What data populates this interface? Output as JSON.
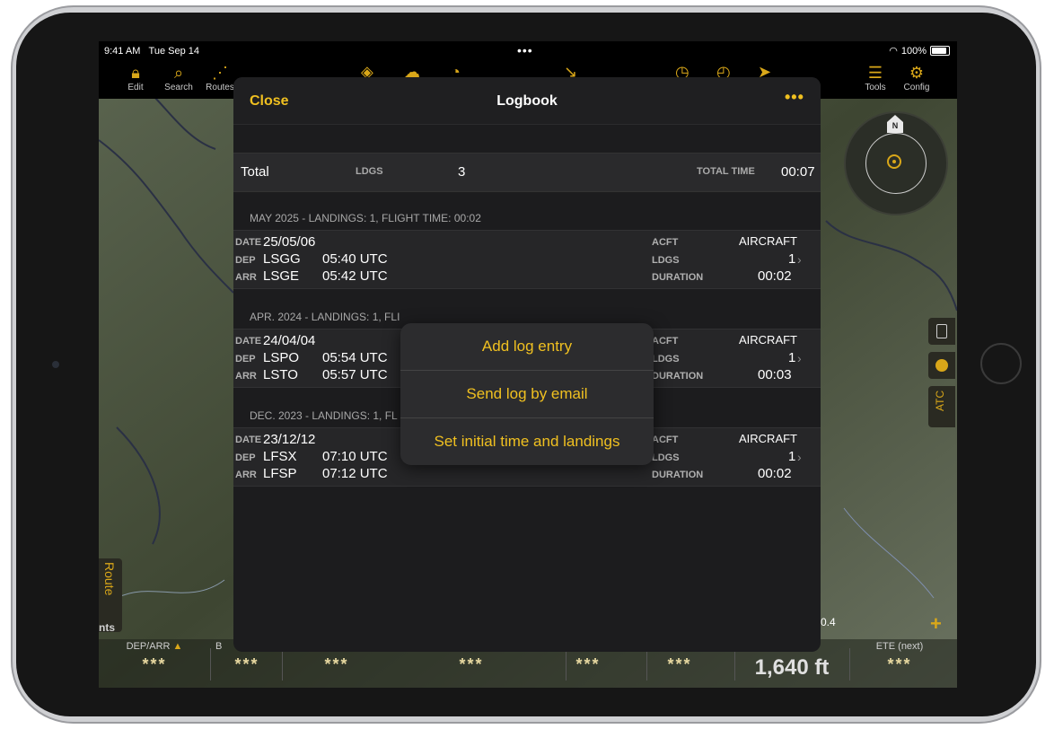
{
  "status_bar": {
    "time": "9:41 AM",
    "date": "Tue Sep 14",
    "battery": "100%"
  },
  "toolbar": {
    "items": [
      {
        "label": "Edit",
        "icon": "lock-icon"
      },
      {
        "label": "Search",
        "icon": "search-icon"
      },
      {
        "label": "Routes",
        "icon": "routes-icon"
      },
      {
        "label": "Tools",
        "icon": "menu-icon"
      },
      {
        "label": "Config",
        "icon": "gear-icon"
      }
    ]
  },
  "logbook": {
    "close_label": "Close",
    "title": "Logbook",
    "more_label": "•••",
    "total": {
      "label": "Total",
      "ldgs_label": "LDGS",
      "ldgs_value": "3",
      "total_time_label": "TOTAL TIME",
      "total_time_value": "00:07"
    },
    "sections": [
      {
        "header": "MAY 2025 - LANDINGS: 1, FLIGHT TIME: 00:02",
        "entry": {
          "date_label": "DATE",
          "date": "25/05/06",
          "dep_label": "DEP",
          "dep": "LSGG",
          "dep_time": "05:40 UTC",
          "arr_label": "ARR",
          "arr": "LSGE",
          "arr_time": "05:42 UTC",
          "acft_label": "ACFT",
          "acft": "AIRCRAFT",
          "ldgs_label": "LDGS",
          "ldgs": "1",
          "duration_label": "DURATION",
          "duration": "00:02"
        }
      },
      {
        "header": "APR. 2024 - LANDINGS: 1, FLI",
        "entry": {
          "date_label": "DATE",
          "date": "24/04/04",
          "dep_label": "DEP",
          "dep": "LSPO",
          "dep_time": "05:54 UTC",
          "arr_label": "ARR",
          "arr": "LSTO",
          "arr_time": "05:57 UTC",
          "acft_label": "ACFT",
          "acft": "AIRCRAFT",
          "ldgs_label": "LDGS",
          "ldgs": "1",
          "duration_label": "DURATION",
          "duration": "00:03"
        }
      },
      {
        "header": "DEC. 2023 - LANDINGS: 1, FL",
        "entry": {
          "date_label": "DATE",
          "date": "23/12/12",
          "dep_label": "DEP",
          "dep": "LFSX",
          "dep_time": "07:10 UTC",
          "arr_label": "ARR",
          "arr": "LFSP",
          "arr_time": "07:12 UTC",
          "acft_label": "ACFT",
          "acft": "AIRCRAFT",
          "ldgs_label": "LDGS",
          "ldgs": "1",
          "duration_label": "DURATION",
          "duration": "00:02"
        }
      }
    ]
  },
  "menu": {
    "options": [
      "Add log entry",
      "Send log by email",
      "Set initial time and landings"
    ]
  },
  "map_overlay": {
    "route_tab": "Route",
    "route_tab_suffix": "nts",
    "atc_label": "ATC",
    "scale": "0.4",
    "compass_north": "N"
  },
  "bottom_bar": {
    "cells": [
      {
        "header": "DEP/ARR",
        "value": "***"
      },
      {
        "header": "B",
        "value": "***"
      },
      {
        "header": "",
        "value": "***"
      },
      {
        "header": "",
        "value": "***"
      },
      {
        "header": "",
        "value": "***"
      },
      {
        "header": "",
        "value": "***"
      },
      {
        "header": "",
        "value": "1,640 ft"
      },
      {
        "header": "ETE (next)",
        "value": "***"
      }
    ]
  },
  "colors": {
    "accent": "#f0c020",
    "panel_bg": "#1c1c1e",
    "row_bg": "#262628"
  }
}
